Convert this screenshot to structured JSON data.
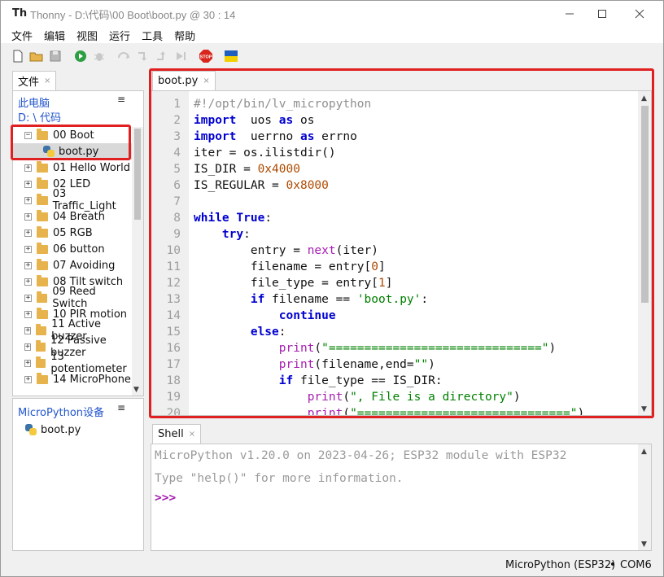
{
  "window": {
    "title": "Thonny  -  D:\\代码\\00 Boot\\boot.py  @  30 : 14",
    "app_glyph": "Th"
  },
  "menu": [
    "文件",
    "编辑",
    "视图",
    "运行",
    "工具",
    "帮助"
  ],
  "toolbar": {
    "icons": [
      "new-file-icon",
      "open-folder-icon",
      "save-icon",
      "run-icon",
      "debug-icon",
      "step-over-icon",
      "step-into-icon",
      "step-out-icon",
      "resume-icon",
      "stop-icon",
      "ukraine-flag-icon"
    ],
    "stop_label": "STOP"
  },
  "files_panel": {
    "tab_label": "文件",
    "close": "×",
    "location_title": "此电脑",
    "location_path": "D: \\ 代码",
    "menu_icon": "≡",
    "tree": [
      {
        "label": "00 Boot",
        "expanded": true,
        "kind": "folder"
      },
      {
        "label": "boot.py",
        "kind": "py",
        "selected": true
      },
      {
        "label": "01 Hello World",
        "kind": "folder"
      },
      {
        "label": "02 LED",
        "kind": "folder"
      },
      {
        "label": "03 Traffic_Light",
        "kind": "folder"
      },
      {
        "label": "04 Breath",
        "kind": "folder"
      },
      {
        "label": "05 RGB",
        "kind": "folder"
      },
      {
        "label": "06 button",
        "kind": "folder"
      },
      {
        "label": "07 Avoiding",
        "kind": "folder"
      },
      {
        "label": "08 Tilt switch",
        "kind": "folder"
      },
      {
        "label": "09 Reed Switch",
        "kind": "folder"
      },
      {
        "label": "10 PIR motion",
        "kind": "folder"
      },
      {
        "label": "11 Active buzzer",
        "kind": "folder"
      },
      {
        "label": "12 Passive buzzer",
        "kind": "folder"
      },
      {
        "label": "13 potentiometer",
        "kind": "folder"
      },
      {
        "label": "14 MicroPhone",
        "kind": "folder"
      }
    ],
    "device_title": "MicroPython设备",
    "device_files": [
      "boot.py"
    ]
  },
  "editor": {
    "tab_label": "boot.py",
    "close": "×",
    "line_numbers": [
      "1",
      "2",
      "3",
      "4",
      "5",
      "6",
      "7",
      "8",
      "9",
      "10",
      "11",
      "12",
      "13",
      "14",
      "15",
      "16",
      "17",
      "18",
      "19",
      "20"
    ],
    "lines": [
      [
        [
          "cm",
          "#!/opt/bin/lv_micropython"
        ]
      ],
      [
        [
          "kw",
          "import"
        ],
        [
          "",
          "  uos "
        ],
        [
          "kw",
          "as"
        ],
        [
          "",
          " os"
        ]
      ],
      [
        [
          "kw",
          "import"
        ],
        [
          "",
          "  uerrno "
        ],
        [
          "kw",
          "as"
        ],
        [
          "",
          " errno"
        ]
      ],
      [
        [
          "",
          "iter = os.ilistdir()"
        ]
      ],
      [
        [
          "",
          "IS_DIR = "
        ],
        [
          "num",
          "0x4000"
        ]
      ],
      [
        [
          "",
          "IS_REGULAR = "
        ],
        [
          "num",
          "0x8000"
        ]
      ],
      [],
      [
        [
          "kw",
          "while"
        ],
        [
          "",
          " "
        ],
        [
          "kw",
          "True"
        ],
        [
          "",
          ":"
        ]
      ],
      [
        [
          "",
          "    "
        ],
        [
          "kw",
          "try"
        ],
        [
          "",
          ":"
        ]
      ],
      [
        [
          "",
          "        entry = "
        ],
        [
          "bi",
          "next"
        ],
        [
          "",
          "(iter)"
        ]
      ],
      [
        [
          "",
          "        filename = entry["
        ],
        [
          "num",
          "0"
        ],
        [
          "",
          "]"
        ]
      ],
      [
        [
          "",
          "        file_type = entry["
        ],
        [
          "num",
          "1"
        ],
        [
          "",
          "]"
        ]
      ],
      [
        [
          "",
          "        "
        ],
        [
          "kw",
          "if"
        ],
        [
          "",
          " filename == "
        ],
        [
          "str",
          "'boot.py'"
        ],
        [
          "",
          ":"
        ]
      ],
      [
        [
          "",
          "            "
        ],
        [
          "kw",
          "continue"
        ]
      ],
      [
        [
          "",
          "        "
        ],
        [
          "kw",
          "else"
        ],
        [
          "",
          ":"
        ]
      ],
      [
        [
          "",
          "            "
        ],
        [
          "bi",
          "print"
        ],
        [
          "",
          "("
        ],
        [
          "str",
          "\"==============================\""
        ],
        [
          "",
          ")"
        ]
      ],
      [
        [
          "",
          "            "
        ],
        [
          "bi",
          "print"
        ],
        [
          "",
          "(filename,end="
        ],
        [
          "str",
          "\"\""
        ],
        [
          "",
          ")"
        ]
      ],
      [
        [
          "",
          "            "
        ],
        [
          "kw",
          "if"
        ],
        [
          "",
          " file_type == IS_DIR:"
        ]
      ],
      [
        [
          "",
          "                "
        ],
        [
          "bi",
          "print"
        ],
        [
          "",
          "("
        ],
        [
          "str",
          "\", File is a directory\""
        ],
        [
          "",
          ")"
        ]
      ],
      [
        [
          "",
          "                "
        ],
        [
          "bi",
          "print"
        ],
        [
          "",
          "("
        ],
        [
          "str",
          "\"==============================\""
        ],
        [
          "",
          ")"
        ]
      ]
    ]
  },
  "shell": {
    "tab_label": "Shell",
    "close": "×",
    "line1": "MicroPython v1.20.0 on 2023-04-26; ESP32 module with ESP32",
    "line2": "Type \"help()\" for more information.",
    "prompt": ">>>"
  },
  "status": {
    "interpreter": "MicroPython (ESP32)",
    "separator": "•",
    "port": "COM6"
  },
  "colors": {
    "highlight_red": "#e02020",
    "keyword": "#0000d0",
    "number": "#ad4a00",
    "string": "#008000",
    "builtin": "#a51cb0"
  }
}
